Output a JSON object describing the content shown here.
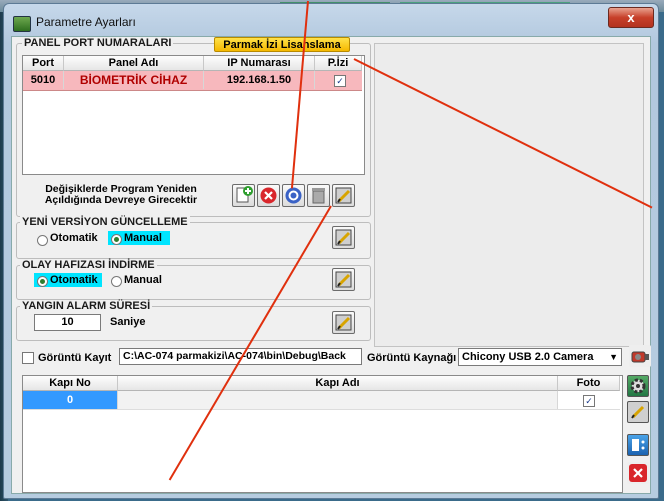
{
  "window": {
    "title": "Parametre Ayarları",
    "close_glyph": "x"
  },
  "panel_port": {
    "group_title": "PANEL PORT NUMARALARI",
    "license_button": "Parmak İzi Lisanslama",
    "columns": [
      "Port",
      "Panel Adı",
      "IP Numarası",
      "P.İzi"
    ],
    "rows": [
      {
        "port": "5010",
        "name": "BİOMETRİK CİHAZ",
        "ip": "192.168.1.50",
        "pizi": "✓"
      }
    ],
    "restart_note_line1": "Değişiklerde Program Yeniden",
    "restart_note_line2": "Açıldığında Devreye Girecektir",
    "toolbar_icons": [
      "add-icon",
      "delete-icon",
      "refresh-icon",
      "trash-icon",
      "edit-icon"
    ]
  },
  "version_update": {
    "group_title": "YENİ VERSİYON GÜNCELLEME",
    "opt_auto": "Otomatik",
    "opt_manual": "Manual",
    "selected": "Manual"
  },
  "event_download": {
    "group_title": "OLAY HAFIZASI İNDİRME",
    "opt_auto": "Otomatik",
    "opt_manual": "Manual",
    "selected": "Otomatik"
  },
  "fire_alarm": {
    "group_title": "YANGIN ALARM SÜRESİ",
    "value": "10",
    "unit": "Saniye"
  },
  "capture": {
    "checkbox_label": "Görüntü Kayıt",
    "path": "C:\\AC-074 parmakizi\\AC-074\\bin\\Debug\\Back",
    "source_label": "Görüntü Kaynağı",
    "source_value": "Chicony USB 2.0 Camera"
  },
  "door_table": {
    "columns": [
      "Kapı No",
      "Kapı Adı",
      "Foto"
    ],
    "rows": [
      {
        "no": "0",
        "name": "",
        "foto": "✓"
      }
    ]
  },
  "colors": {
    "accent_cyan": "#00e5ff",
    "row_pink": "#f7b8bd",
    "arrow_red": "#e0300e",
    "license_yellow": "#ffd200"
  }
}
